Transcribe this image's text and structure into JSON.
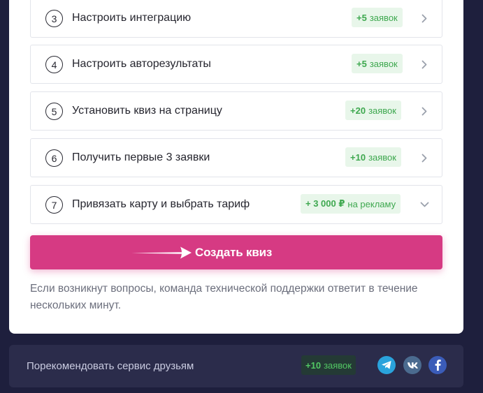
{
  "steps": [
    {
      "num": "3",
      "label": "Настроить интеграцию",
      "bonus_amount": "+5",
      "bonus_unit": "заявок",
      "expanded": false
    },
    {
      "num": "4",
      "label": "Настроить авторезультаты",
      "bonus_amount": "+5",
      "bonus_unit": "заявок",
      "expanded": false
    },
    {
      "num": "5",
      "label": "Установить квиз на страницу",
      "bonus_amount": "+20",
      "bonus_unit": "заявок",
      "expanded": false
    },
    {
      "num": "6",
      "label": "Получить первые 3 заявки",
      "bonus_amount": "+10",
      "bonus_unit": "заявок",
      "expanded": false
    },
    {
      "num": "7",
      "label": "Привязать карту и выбрать тариф",
      "bonus_amount": "+ 3 000 ₽",
      "bonus_unit": "на рекламу",
      "expanded": true
    }
  ],
  "cta": {
    "label": "Создать квиз"
  },
  "support_note": "Если возникнут вопросы, команда технической поддержки ответит в течение нескольких минут.",
  "footer": {
    "label": "Порекомендовать сервис друзьям",
    "bonus_amount": "+10",
    "bonus_unit": "заявок",
    "social": [
      "telegram-icon",
      "vk-icon",
      "facebook-icon"
    ]
  },
  "colors": {
    "background": "#1e1f3d",
    "card": "#ffffff",
    "cta": "#d63a83",
    "badge_bg": "#e8f6ea",
    "badge_text": "#3ea84f",
    "telegram": "#2aa3dc",
    "vk": "#4b6b8f",
    "facebook": "#3b5cb8"
  }
}
